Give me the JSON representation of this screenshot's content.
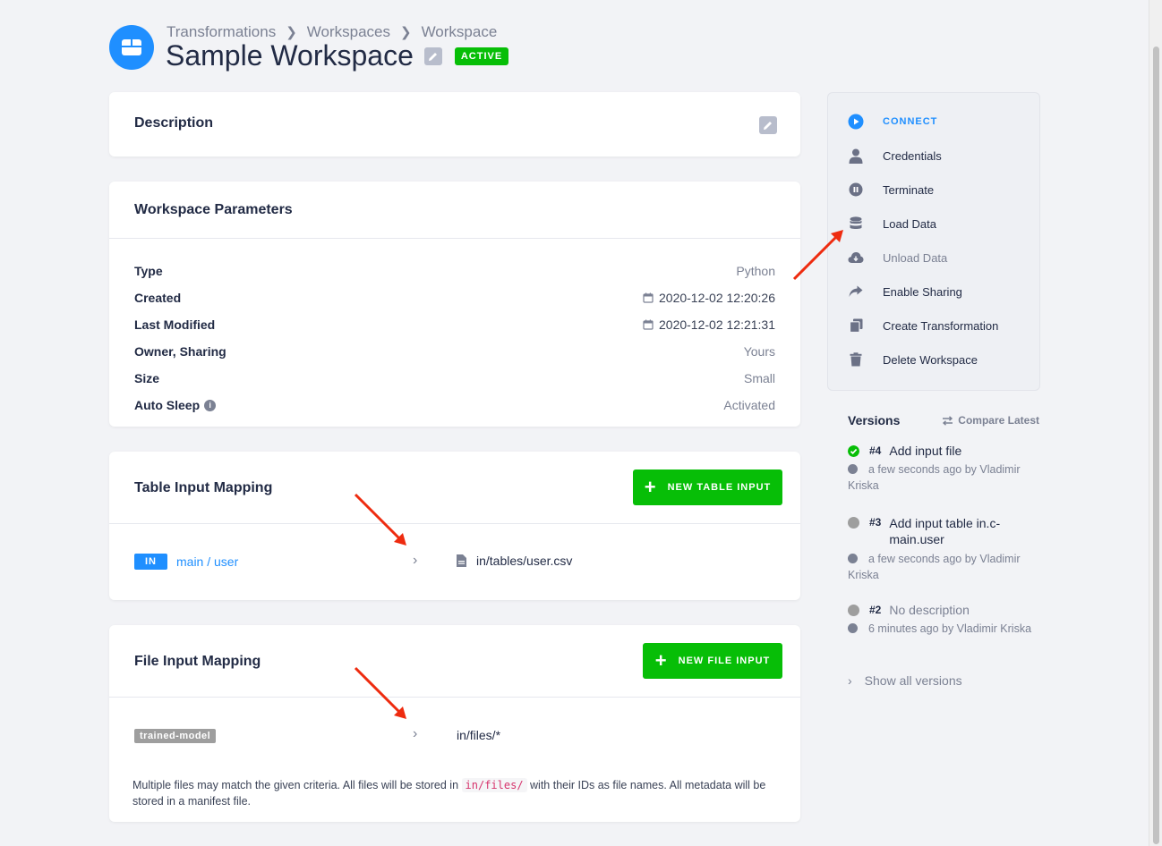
{
  "header": {
    "breadcrumb": [
      "Transformations",
      "Workspaces",
      "Workspace"
    ],
    "title": "Sample Workspace",
    "status_badge": "ACTIVE"
  },
  "description_card": {
    "title": "Description"
  },
  "parameters_card": {
    "title": "Workspace Parameters",
    "rows": [
      {
        "key": "Type",
        "value": "Python"
      },
      {
        "key": "Created",
        "value": "2020-12-02 12:20:26"
      },
      {
        "key": "Last Modified",
        "value": "2020-12-02 12:21:31"
      },
      {
        "key": "Owner, Sharing",
        "value": "Yours"
      },
      {
        "key": "Size",
        "value": "Small"
      },
      {
        "key": "Auto Sleep",
        "value": "Activated"
      }
    ]
  },
  "table_input": {
    "title": "Table Input Mapping",
    "button_label": "NEW TABLE INPUT",
    "row": {
      "tag": "IN",
      "source": "main / user",
      "destination": "in/tables/user.csv"
    }
  },
  "file_input": {
    "title": "File Input Mapping",
    "button_label": "NEW FILE INPUT",
    "row": {
      "tag": "trained-model",
      "destination": "in/files/*"
    },
    "note_before": "Multiple files may match the given criteria. All files will be stored in ",
    "note_code": "in/files/",
    "note_after": " with their IDs as file names. All metadata will be stored in a manifest file."
  },
  "actions": {
    "connect": "CONNECT",
    "credentials": "Credentials",
    "terminate": "Terminate",
    "load_data": "Load Data",
    "unload_data": "Unload Data",
    "enable_sharing": "Enable Sharing",
    "create_transformation": "Create Transformation",
    "delete_workspace": "Delete Workspace"
  },
  "versions": {
    "title": "Versions",
    "compare_label": "Compare Latest",
    "items": [
      {
        "number": "#4",
        "description": "Add input file",
        "meta": "a few seconds ago by Vladimir Kriska",
        "status_color": "#07be07"
      },
      {
        "number": "#3",
        "description": "Add input table in.c-main.user",
        "meta": "a few seconds ago by Vladimir Kriska",
        "status_color": "#9e9e9e"
      },
      {
        "number": "#2",
        "description": "No description",
        "meta": "6 minutes ago by Vladimir Kriska",
        "status_color": "#9e9e9e"
      }
    ],
    "show_all": "Show all versions"
  },
  "colors": {
    "accent": "#1f8fff",
    "success": "#07be07",
    "annotation": "#ee2b0f"
  }
}
